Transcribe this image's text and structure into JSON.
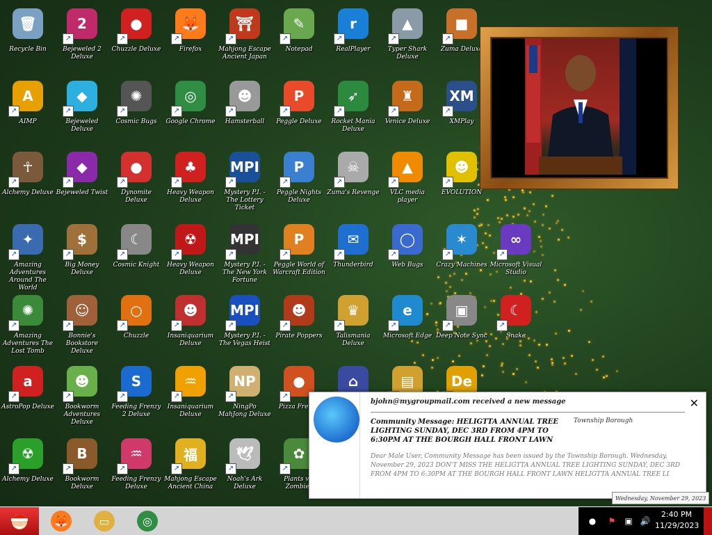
{
  "desktop": {
    "icons": [
      {
        "label": "Recycle Bin",
        "glyph": "🗑",
        "color": "#7aa0c4",
        "shortcut": false
      },
      {
        "label": "Bejeweled 2 Deluxe",
        "glyph": "2",
        "color": "#c02a6a",
        "shortcut": true
      },
      {
        "label": "Chuzzle Deluxe",
        "glyph": "●",
        "color": "#d02020",
        "shortcut": true
      },
      {
        "label": "Firefox",
        "glyph": "🦊",
        "color": "#ff7a1a",
        "shortcut": true
      },
      {
        "label": "Mahjong Escape Ancient Japan",
        "glyph": "⛩",
        "color": "#c0391d",
        "shortcut": true
      },
      {
        "label": "Notepad",
        "glyph": "✎",
        "color": "#6aa84f",
        "shortcut": true
      },
      {
        "label": "RealPlayer",
        "glyph": "r",
        "color": "#1a7fd6",
        "shortcut": true
      },
      {
        "label": "Typer Shark Deluxe",
        "glyph": "▲",
        "color": "#8a9aa6",
        "shortcut": true
      },
      {
        "label": "Zuma Deluxe",
        "glyph": "■",
        "color": "#c8702a",
        "shortcut": true
      },
      {
        "label": "AIMP",
        "glyph": "A",
        "color": "#e8a000",
        "shortcut": true
      },
      {
        "label": "Bejeweled Deluxe",
        "glyph": "◆",
        "color": "#2bb0e0",
        "shortcut": true
      },
      {
        "label": "Cosmic Bugs",
        "glyph": "✺",
        "color": "#555",
        "shortcut": true
      },
      {
        "label": "Google Chrome",
        "glyph": "◎",
        "color": "#2f8e43",
        "shortcut": true
      },
      {
        "label": "Hamsterball",
        "glyph": "☻",
        "color": "#999",
        "shortcut": true
      },
      {
        "label": "Peggle Deluxe",
        "glyph": "P",
        "color": "#e84a2a",
        "shortcut": true
      },
      {
        "label": "Rocket Mania Deluxe",
        "glyph": "➶",
        "color": "#2b8a3e",
        "shortcut": true
      },
      {
        "label": "Venice Deluxe",
        "glyph": "♜",
        "color": "#c46a1a",
        "shortcut": true
      },
      {
        "label": "XMPlay",
        "glyph": "XM",
        "color": "#2a4f8a",
        "shortcut": true
      },
      {
        "label": "Alchemy Deluxe",
        "glyph": "☥",
        "color": "#7a5a3a",
        "shortcut": true
      },
      {
        "label": "Bejeweled Twist",
        "glyph": "◆",
        "color": "#8a2aa8",
        "shortcut": true
      },
      {
        "label": "Dynomite Deluxe",
        "glyph": "●",
        "color": "#d43030",
        "shortcut": true
      },
      {
        "label": "Heavy Weapon Deluxe",
        "glyph": "♣",
        "color": "#d02020",
        "shortcut": true
      },
      {
        "label": "Mystery P.I. - The Lottery Ticket",
        "glyph": "MPI",
        "color": "#1a4f9a",
        "shortcut": true
      },
      {
        "label": "Peggle Nights Deluxe",
        "glyph": "P",
        "color": "#3a7fd0",
        "shortcut": true
      },
      {
        "label": "Zuma's Revenge",
        "glyph": "☠",
        "color": "#aaa",
        "shortcut": true
      },
      {
        "label": "VLC media player",
        "glyph": "▲",
        "color": "#f08a00",
        "shortcut": true
      },
      {
        "label": "EVOLUTION",
        "glyph": "☻",
        "color": "#e0c000",
        "shortcut": true
      },
      {
        "label": "Amazing Adventures Around The World",
        "glyph": "✦",
        "color": "#3a6ab0",
        "shortcut": true
      },
      {
        "label": "Big Money Deluxe",
        "glyph": "$",
        "color": "#a0703a",
        "shortcut": true
      },
      {
        "label": "Cosmic Knight",
        "glyph": "☾",
        "color": "#888",
        "shortcut": true
      },
      {
        "label": "Heavy Weapon Deluxe",
        "glyph": "☢",
        "color": "#c01818",
        "shortcut": true
      },
      {
        "label": "Mystery P.I. - The New York Fortune",
        "glyph": "MPI",
        "color": "#333",
        "shortcut": true
      },
      {
        "label": "Peggle World of Warcraft Edition",
        "glyph": "P",
        "color": "#e08020",
        "shortcut": true
      },
      {
        "label": "Thunderbird",
        "glyph": "✉",
        "color": "#1f6fd0",
        "shortcut": true
      },
      {
        "label": "Web Bugs",
        "glyph": "◯",
        "color": "#3a6ad0",
        "shortcut": true
      },
      {
        "label": "Crazy Machines",
        "glyph": "✶",
        "color": "#2a8ad0",
        "shortcut": true
      },
      {
        "label": "Microsoft Visual Studio",
        "glyph": "∞",
        "color": "#6a3ac0",
        "shortcut": true
      },
      {
        "label": "Amazing Adventures The Lost Tomb",
        "glyph": "✺",
        "color": "#3a8a3a",
        "shortcut": true
      },
      {
        "label": "Bonnie's Bookstore Deluxe",
        "glyph": "☺",
        "color": "#a0603a",
        "shortcut": true
      },
      {
        "label": "Chuzzle",
        "glyph": "○",
        "color": "#e07010",
        "shortcut": true
      },
      {
        "label": "Insaniquarium Deluxe",
        "glyph": "☻",
        "color": "#c03030",
        "shortcut": true
      },
      {
        "label": "Mystery P.I. - The Vegas Heist",
        "glyph": "MPI",
        "color": "#1a4fc0",
        "shortcut": true
      },
      {
        "label": "Pirate Poppers",
        "glyph": "☻",
        "color": "#b03a1a",
        "shortcut": true
      },
      {
        "label": "Talismania Deluxe",
        "glyph": "♛",
        "color": "#d0a030",
        "shortcut": true
      },
      {
        "label": "Microsoft Edge",
        "glyph": "e",
        "color": "#1f8ad0",
        "shortcut": true
      },
      {
        "label": "Deep Note Sync",
        "glyph": "▣",
        "color": "#888",
        "shortcut": true
      },
      {
        "label": "Snake",
        "glyph": "☾",
        "color": "#d02020",
        "shortcut": true
      },
      {
        "label": "AstroPop Deluxe",
        "glyph": "a",
        "color": "#d02020",
        "shortcut": true
      },
      {
        "label": "Bookworm Adventures Deluxe",
        "glyph": "☻",
        "color": "#6ab04a",
        "shortcut": true
      },
      {
        "label": "Feeding Frenzy 2 Deluxe",
        "glyph": "S",
        "color": "#1a6ad0",
        "shortcut": true
      },
      {
        "label": "Insaniquarium Deluxe",
        "glyph": "♒",
        "color": "#f0a000",
        "shortcut": true
      },
      {
        "label": "NingPo MahJong Deluxe",
        "glyph": "NP",
        "color": "#d0b070",
        "shortcut": true
      },
      {
        "label": "Pizza Frenzy",
        "glyph": "●",
        "color": "#d05020",
        "shortcut": true
      },
      {
        "label": "",
        "glyph": "⌂",
        "color": "#3a4aa0",
        "shortcut": true
      },
      {
        "label": "",
        "glyph": "▤",
        "color": "#d0a030",
        "shortcut": true
      },
      {
        "label": "",
        "glyph": "De",
        "color": "#e0a000",
        "shortcut": true
      },
      {
        "label": "Alchemy Deluxe",
        "glyph": "☢",
        "color": "#2aa02a",
        "shortcut": true
      },
      {
        "label": "Bookworm Deluxe",
        "glyph": "B",
        "color": "#8a5a2a",
        "shortcut": true
      },
      {
        "label": "Feeding Frenzy Deluxe",
        "glyph": "♒",
        "color": "#d03a6a",
        "shortcut": true
      },
      {
        "label": "Mahjong Escape Ancient China",
        "glyph": "福",
        "color": "#e0b020",
        "shortcut": true
      },
      {
        "label": "Noah's Ark Deluxe",
        "glyph": "🕊",
        "color": "#bbb",
        "shortcut": true
      },
      {
        "label": "Plants vs. Zombies",
        "glyph": "✿",
        "color": "#4a8a3a",
        "shortcut": true
      }
    ]
  },
  "notification": {
    "from": "bjohn@mygroupmail.com received a new message",
    "subject": "Community Message: HELIGTTA ANNUAL TREE LIGHTING SUNDAY, DEC 3RD FROM 4PM TO 6:30PM AT THE BOURGH HALL FRONT LAWN",
    "sender": "Township Borough",
    "body": "Dear Male User, Community Message has been issued by the Township Borough. Wednesday, November 29, 2023 DON'T MISS THE HELIGTTA ANNUAL TREE LIGHTING SUNDAY, DEC 3RD FROM 4PM TO 6:30PM AT THE BOURGH HALL FRONT LAWN HELIGTTA ANNUAL TREE LI",
    "close": "✕"
  },
  "tooltip": "Wednesday, November 29, 2023",
  "taskbar": {
    "pinned": [
      {
        "name": "firefox-taskbar-button",
        "glyph": "🦊",
        "color": "#ff7a1a"
      },
      {
        "name": "file-explorer-taskbar-button",
        "glyph": "▭",
        "color": "#e0b040"
      },
      {
        "name": "chrome-taskbar-button",
        "glyph": "◎",
        "color": "#2f8e43"
      }
    ],
    "time": "2:40 PM",
    "date": "11/29/2023"
  }
}
